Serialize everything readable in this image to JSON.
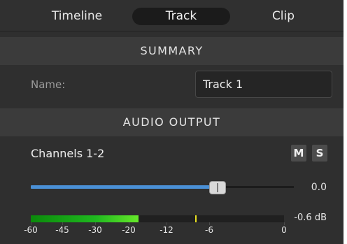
{
  "tabs": [
    {
      "label": "Timeline",
      "active": false
    },
    {
      "label": "Track",
      "active": true
    },
    {
      "label": "Clip",
      "active": false
    }
  ],
  "summary": {
    "header": "SUMMARY",
    "name_label": "Name:",
    "name_value": "Track 1"
  },
  "audio_output": {
    "header": "AUDIO OUTPUT",
    "channels_label": "Channels 1-2",
    "mute_label": "M",
    "solo_label": "S",
    "volume_value": "0.0",
    "volume_fraction": 0.71,
    "meter": {
      "level_db": -18,
      "peak_db": -8,
      "peak_label": "-0.6 dB",
      "scale": [
        "-60",
        "-45",
        "-30",
        "-20",
        "-12",
        "-6",
        "0"
      ],
      "scale_values": [
        -60,
        -45,
        -30,
        -20,
        -12,
        -6,
        0
      ]
    }
  },
  "colors": {
    "panel_bg": "#2f2f2f",
    "header_bg": "#3b3b3b",
    "accent_blue": "#4a90d6",
    "meter_green": "#1fb81f",
    "peak_yellow": "#e8e020"
  }
}
